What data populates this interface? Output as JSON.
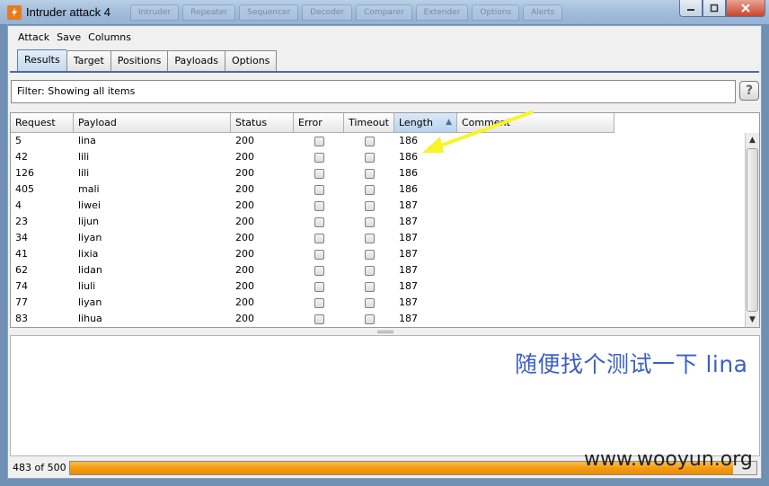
{
  "window": {
    "title": "Intruder attack 4",
    "background_tabs": [
      "Intruder",
      "Repeater",
      "Sequencer",
      "Decoder",
      "Comparer",
      "Extender",
      "Options",
      "Alerts"
    ]
  },
  "menu": [
    "Attack",
    "Save",
    "Columns"
  ],
  "tabs": [
    {
      "label": "Results",
      "active": true
    },
    {
      "label": "Target",
      "active": false
    },
    {
      "label": "Positions",
      "active": false
    },
    {
      "label": "Payloads",
      "active": false
    },
    {
      "label": "Options",
      "active": false
    }
  ],
  "filter": {
    "text": "Filter:  Showing all items",
    "help": "?"
  },
  "table": {
    "columns": [
      {
        "label": "Request",
        "sorted": false
      },
      {
        "label": "Payload",
        "sorted": false
      },
      {
        "label": "Status",
        "sorted": false
      },
      {
        "label": "Error",
        "sorted": false
      },
      {
        "label": "Timeout",
        "sorted": false
      },
      {
        "label": "Length",
        "sorted": true
      },
      {
        "label": "Comment",
        "sorted": false
      }
    ],
    "rows": [
      {
        "request": "5",
        "payload": "lina",
        "status": "200",
        "error": false,
        "timeout": false,
        "length": "186",
        "comment": ""
      },
      {
        "request": "42",
        "payload": "lili",
        "status": "200",
        "error": false,
        "timeout": false,
        "length": "186",
        "comment": ""
      },
      {
        "request": "126",
        "payload": "lili",
        "status": "200",
        "error": false,
        "timeout": false,
        "length": "186",
        "comment": ""
      },
      {
        "request": "405",
        "payload": "mali",
        "status": "200",
        "error": false,
        "timeout": false,
        "length": "186",
        "comment": ""
      },
      {
        "request": "4",
        "payload": "liwei",
        "status": "200",
        "error": false,
        "timeout": false,
        "length": "187",
        "comment": ""
      },
      {
        "request": "23",
        "payload": "lijun",
        "status": "200",
        "error": false,
        "timeout": false,
        "length": "187",
        "comment": ""
      },
      {
        "request": "34",
        "payload": "liyan",
        "status": "200",
        "error": false,
        "timeout": false,
        "length": "187",
        "comment": ""
      },
      {
        "request": "41",
        "payload": "lixia",
        "status": "200",
        "error": false,
        "timeout": false,
        "length": "187",
        "comment": ""
      },
      {
        "request": "62",
        "payload": "lidan",
        "status": "200",
        "error": false,
        "timeout": false,
        "length": "187",
        "comment": ""
      },
      {
        "request": "74",
        "payload": "liuli",
        "status": "200",
        "error": false,
        "timeout": false,
        "length": "187",
        "comment": ""
      },
      {
        "request": "77",
        "payload": "liyan",
        "status": "200",
        "error": false,
        "timeout": false,
        "length": "187",
        "comment": ""
      },
      {
        "request": "83",
        "payload": "lihua",
        "status": "200",
        "error": false,
        "timeout": false,
        "length": "187",
        "comment": ""
      }
    ]
  },
  "annotation": "随便找个测试一下 lina",
  "progress": {
    "text": "483 of 500",
    "done": 483,
    "total": 500
  },
  "watermark": "www.wooyun.org",
  "colors": {
    "accent": "#4a6e99",
    "progress": "#f39a0e",
    "annotation": "#3b5fc6",
    "highlight_arrow": "#f5f52a"
  }
}
